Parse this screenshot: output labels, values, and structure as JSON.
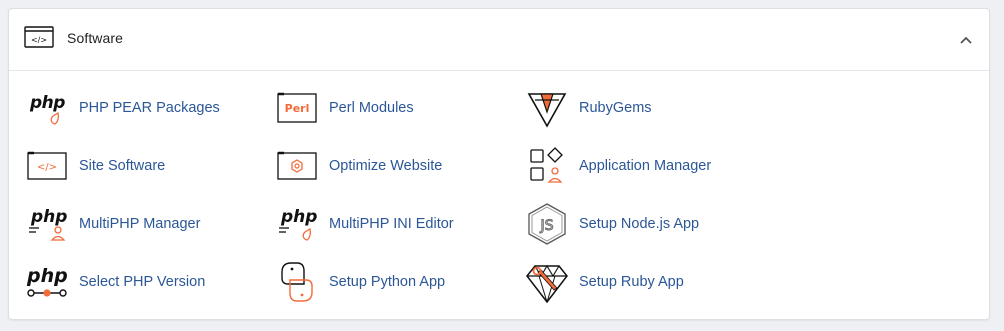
{
  "panel": {
    "title": "Software",
    "icon": "code-window-icon",
    "collapse_icon": "chevron-up-icon"
  },
  "items": [
    {
      "label": "PHP PEAR Packages",
      "icon": "php-pear-icon"
    },
    {
      "label": "Perl Modules",
      "icon": "perl-icon",
      "icon_text": "Perl"
    },
    {
      "label": "RubyGems",
      "icon": "rubygems-icon"
    },
    {
      "label": "Site Software",
      "icon": "code-window-icon"
    },
    {
      "label": "Optimize Website",
      "icon": "optimize-icon"
    },
    {
      "label": "Application Manager",
      "icon": "app-manager-icon"
    },
    {
      "label": "MultiPHP Manager",
      "icon": "multiphp-manager-icon"
    },
    {
      "label": "MultiPHP INI Editor",
      "icon": "multiphp-ini-icon"
    },
    {
      "label": "Setup Node.js App",
      "icon": "nodejs-icon",
      "icon_text": "JS"
    },
    {
      "label": "Select PHP Version",
      "icon": "php-version-icon"
    },
    {
      "label": "Setup Python App",
      "icon": "python-icon"
    },
    {
      "label": "Setup Ruby App",
      "icon": "ruby-app-icon"
    }
  ],
  "icon_word": "php",
  "colors": {
    "accent": "#f26b3a",
    "link": "#2b5797",
    "text": "#222222"
  }
}
